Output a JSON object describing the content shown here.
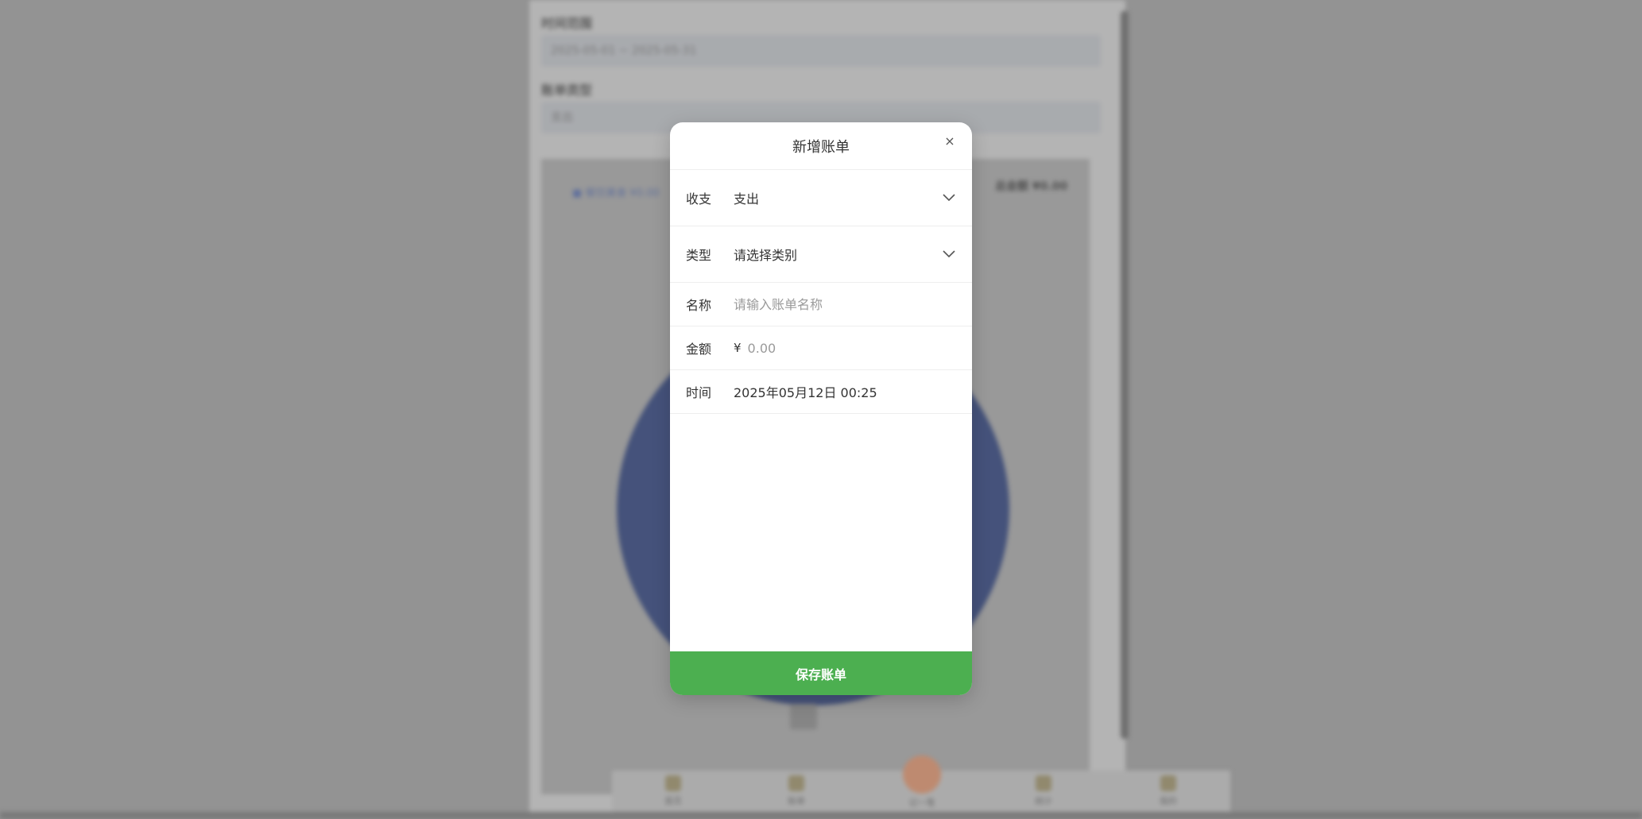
{
  "background": {
    "date_range_label": "时间范围",
    "date_range_value": "2025-05-01 ~ 2025-05-31",
    "filter_label": "账单类型",
    "filter_value": "支出",
    "legend": "■ 餐饮美食 ¥0.00",
    "total": "总金额 ¥0.00",
    "tabs": [
      "首页",
      "账单",
      "记一笔",
      "统计",
      "我的"
    ]
  },
  "modal": {
    "title": "新增账单",
    "close_icon": "×",
    "fields": {
      "type": {
        "label": "收支",
        "value": "支出"
      },
      "category": {
        "label": "类型",
        "value": "请选择类别"
      },
      "name": {
        "label": "名称",
        "placeholder": "请输入账单名称",
        "value": ""
      },
      "amount": {
        "label": "金额",
        "currency": "¥",
        "placeholder": "0.00",
        "value": ""
      },
      "time": {
        "label": "时间",
        "value": "2025年05月12日 00:25"
      }
    },
    "save_label": "保存账单"
  },
  "colors": {
    "accent": "#4caf50",
    "pie": "#34467c",
    "fab": "#d6916e"
  }
}
